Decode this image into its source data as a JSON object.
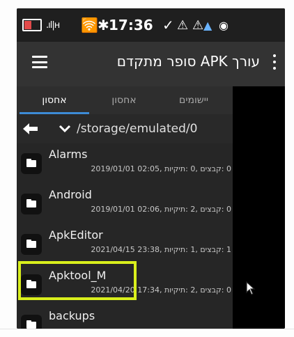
{
  "status_bar": {
    "signal_text": ".ıl|н",
    "time": "17:36",
    "icons": [
      "battery-icon",
      "signal-icon",
      "wifi-icon",
      "bluetooth-icon",
      "check-icon",
      "warning-icon",
      "warning-icon",
      "android-icon",
      "cast-icon"
    ]
  },
  "toolbar": {
    "title": "עורך APK סופר מתקדם",
    "menu_icon": "hamburger-menu-icon",
    "overflow_icon": "more-vert-icon"
  },
  "tabs": [
    {
      "label": "אחסון",
      "active": true
    },
    {
      "label": "אחסון",
      "active": false
    },
    {
      "label": "יישומים",
      "active": false
    }
  ],
  "path_bar": {
    "path": "/storage/emulated/0",
    "back_icon": "back-arrow-icon",
    "chevron_icon": "chevron-down-icon"
  },
  "files": [
    {
      "name": "Alarms",
      "meta": "0 :קבצים ,0 :תיקיות ,02:05 2019/01/01"
    },
    {
      "name": "Android",
      "meta": "0 :קבצים ,2 :תיקיות ,02:06 2019/01/01"
    },
    {
      "name": "ApkEditor",
      "meta": "1 :קבצים ,1 :תיקיות ,23:38 2021/04/15"
    },
    {
      "name": "Apktool_M",
      "meta": "0 :קבצים ,2 :תיקיות ,17:34 2021/04/20"
    },
    {
      "name": "backups",
      "meta": ""
    }
  ],
  "colors": {
    "highlight": "#d9ef1c",
    "tab_indicator": "#3d8bd6",
    "toolbar": "#333333"
  }
}
